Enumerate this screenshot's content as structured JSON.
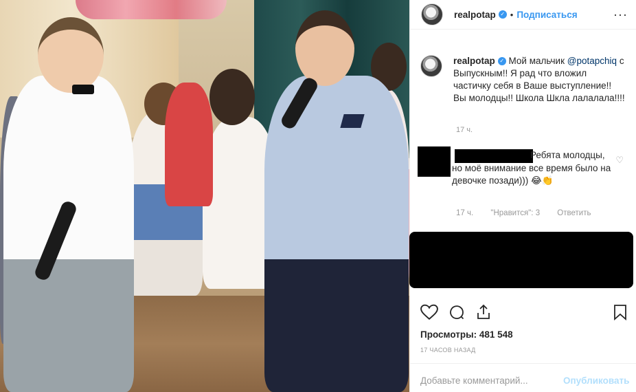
{
  "post": {
    "username": "realpotap",
    "follow_label": "Подписаться",
    "separator": "•",
    "more_label": "···"
  },
  "caption": {
    "username": "realpotap",
    "text_before": "Мой мальчик",
    "mention": "@potapchiq",
    "text_after": "с Выпускным!! Я рад что вложил частичку себя в Ваше выступление!! Вы молодцы!! Школа Шкла лалалала!!!!",
    "time": "17 ч."
  },
  "comment": {
    "text": "Ребята молодцы, но моё внимание все время было на девочке позади))) 😂👏",
    "time": "17 ч.",
    "likes": "\"Нравится\": 3",
    "reply": "Ответить"
  },
  "actions": {
    "like_icon": "heart-icon",
    "comment_icon": "speech-bubble-icon",
    "share_icon": "share-icon",
    "save_icon": "bookmark-icon"
  },
  "stats": {
    "views": "Просмотры: 481 548",
    "ago": "17 часов назад"
  },
  "add_comment": {
    "placeholder": "Добавьте комментарий...",
    "publish_label": "Опубликовать"
  },
  "colors": {
    "accent": "#3897f0",
    "muted": "#999999",
    "publish_disabled": "#b2dffc"
  }
}
